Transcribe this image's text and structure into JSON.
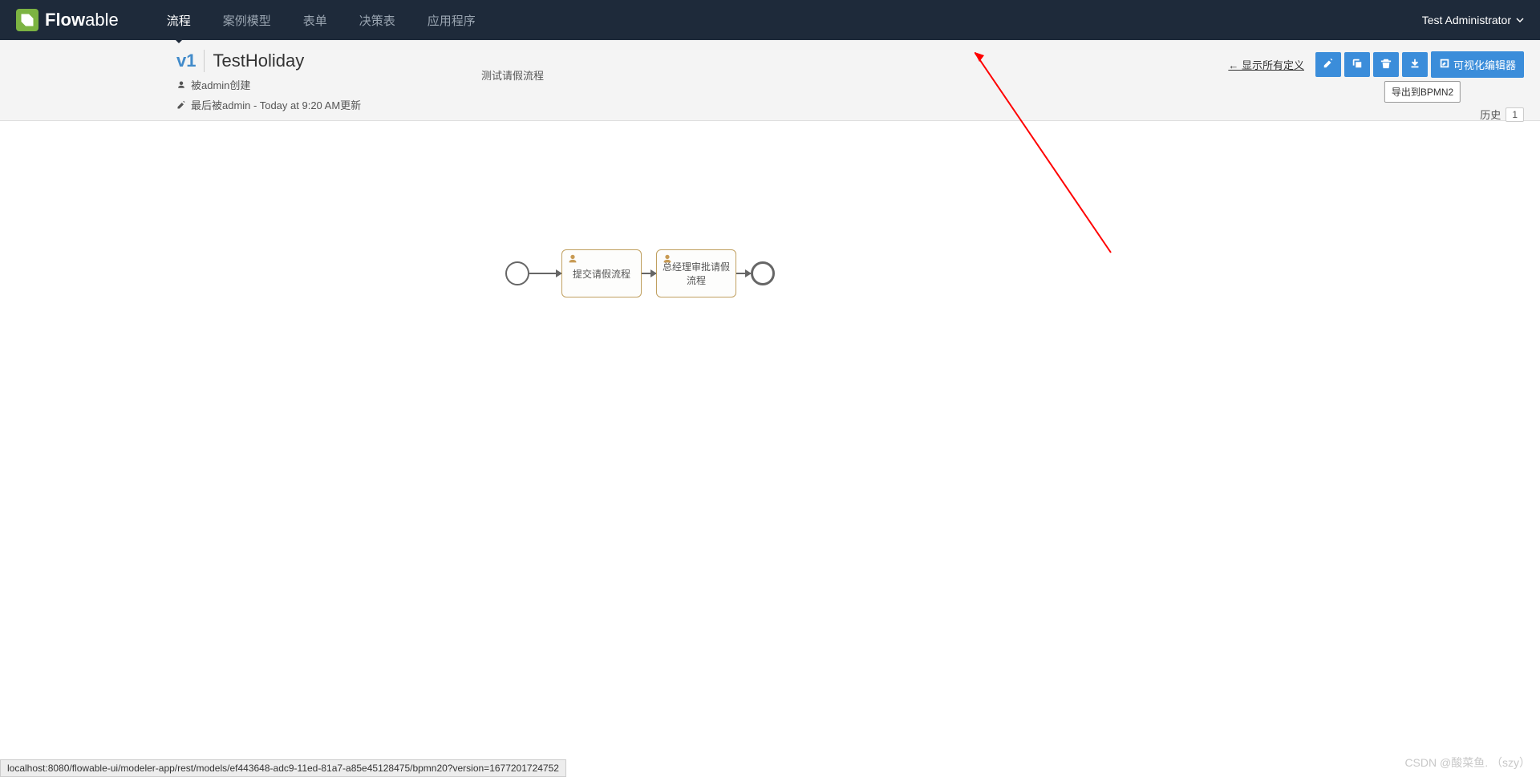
{
  "logo_text_bold": "Flow",
  "logo_text_light": "able",
  "nav": {
    "items": [
      {
        "label": "流程",
        "active": true
      },
      {
        "label": "案例模型",
        "active": false
      },
      {
        "label": "表单",
        "active": false
      },
      {
        "label": "决策表",
        "active": false
      },
      {
        "label": "应用程序",
        "active": false
      }
    ]
  },
  "user_name": "Test Administrator",
  "model": {
    "version": "v1",
    "name": "TestHoliday",
    "created_by": "被admin创建",
    "updated_by": "最后被admin - Today at 9:20 AM更新",
    "description": "测试请假流程"
  },
  "actions": {
    "show_all": "← 显示所有定义",
    "visual_editor": "可视化编辑器",
    "tooltip_export": "导出到BPMN2"
  },
  "history": {
    "label": "历史",
    "count": "1"
  },
  "diagram": {
    "start": "start-event",
    "task1": "提交请假流程",
    "task2": "总经理审批请假流程",
    "end": "end-event"
  },
  "status_url": "localhost:8080/flowable-ui/modeler-app/rest/models/ef443648-adc9-11ed-81a7-a85e45128475/bpmn20?version=1677201724752",
  "watermark": "CSDN @酸菜鱼. （szy）"
}
